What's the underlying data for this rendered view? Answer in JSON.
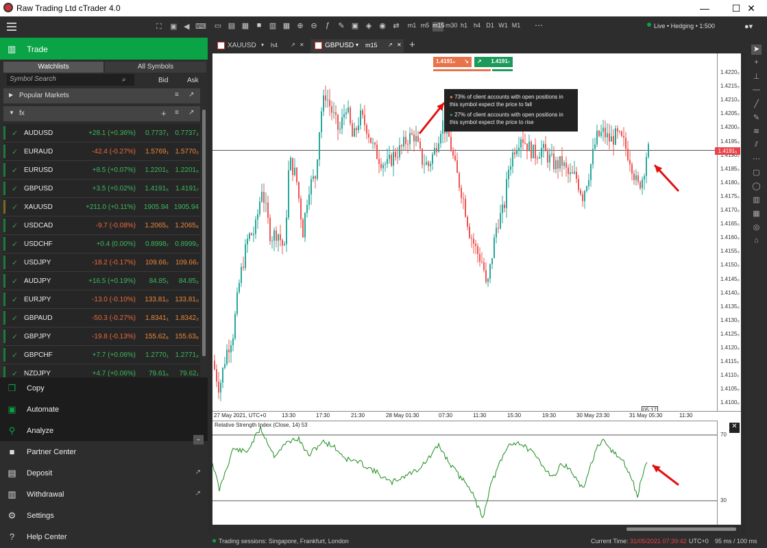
{
  "window": {
    "title": "Raw Trading Ltd cTrader 4.0",
    "minimize": "—",
    "maximize": "☐",
    "close": "✕"
  },
  "trade": {
    "title": "Trade"
  },
  "watch_tabs": [
    "Watchlists",
    "All Symbols"
  ],
  "search": {
    "placeholder": "Symbol Search",
    "bid": "Bid",
    "ask": "Ask"
  },
  "sections": {
    "popular": "Popular Markets",
    "fx": "fx"
  },
  "symbols": [
    {
      "sym": "AUDUSD",
      "chg": "+28.1 (+0.36%)",
      "bid": "0.7737₁",
      "ask": "0.7737₃",
      "dir": "g"
    },
    {
      "sym": "EURAUD",
      "chg": "-42.4 (-0.27%)",
      "bid": "1.5769₁",
      "ask": "1.5770₂",
      "dir": "r"
    },
    {
      "sym": "EURUSD",
      "chg": "+8.5 (+0.07%)",
      "bid": "1.2201₅",
      "ask": "1.2201₆",
      "dir": "g"
    },
    {
      "sym": "GBPUSD",
      "chg": "+3.5 (+0.02%)",
      "bid": "1.4191₅",
      "ask": "1.4191₇",
      "dir": "g"
    },
    {
      "sym": "XAUUSD",
      "chg": "+211.0 (+0.11%)",
      "bid": "1905.94",
      "ask": "1905.94",
      "dir": "g"
    },
    {
      "sym": "USDCAD",
      "chg": "-9.7 (-0.08%)",
      "bid": "1.2065₆",
      "ask": "1.2065₈",
      "dir": "r"
    },
    {
      "sym": "USDCHF",
      "chg": "+0.4 (0.00%)",
      "bid": "0.8998₇",
      "ask": "0.8999₀",
      "dir": "g"
    },
    {
      "sym": "USDJPY",
      "chg": "-18.2 (-0.17%)",
      "bid": "109.66₇",
      "ask": "109.66₇",
      "dir": "r"
    },
    {
      "sym": "AUDJPY",
      "chg": "+16.5 (+0.19%)",
      "bid": "84.85₁",
      "ask": "84.85₃",
      "dir": "g"
    },
    {
      "sym": "EURJPY",
      "chg": "-13.0 (-0.10%)",
      "bid": "133.81₀",
      "ask": "133.81₀",
      "dir": "r"
    },
    {
      "sym": "GBPAUD",
      "chg": "-50.3 (-0.27%)",
      "bid": "1.8341₁",
      "ask": "1.8342₂",
      "dir": "r"
    },
    {
      "sym": "GBPJPY",
      "chg": "-19.8 (-0.13%)",
      "bid": "155.62₈",
      "ask": "155.63₈",
      "dir": "r"
    },
    {
      "sym": "GBPCHF",
      "chg": "+7.7 (+0.06%)",
      "bid": "1.2770₁",
      "ask": "1.2771₂",
      "dir": "g"
    },
    {
      "sym": "NZDJPY",
      "chg": "+4.7 (+0.06%)",
      "bid": "79.61₅",
      "ask": "79.62₁",
      "dir": "g"
    }
  ],
  "menu": [
    "Copy",
    "Automate",
    "Analyze",
    "Partner Center",
    "Deposit",
    "Withdrawal",
    "Settings",
    "Help Center"
  ],
  "account": "Live • Hedging • 1:500",
  "timeframes": [
    "m1",
    "m5",
    "m15",
    "m30",
    "h1",
    "h4",
    "D1",
    "W1",
    "M1"
  ],
  "chart_tabs": [
    {
      "sym": "XAUUSD",
      "tf": "h4"
    },
    {
      "sym": "GBPUSD",
      "tf": "m15"
    }
  ],
  "quote": {
    "sell": "1.4191₅",
    "buy": "1.4191₇",
    "current": "1.4191₅"
  },
  "sentiment": [
    "73% of client accounts with open positions in this symbol expect the price to fall",
    "27% of client accounts with open positions in this symbol expect the price to rise"
  ],
  "yticks": [
    "1.4220₀",
    "1.4215₀",
    "1.4210₀",
    "1.4205₀",
    "1.4200₀",
    "1.4195₀",
    "1.4190₀",
    "1.4185₀",
    "1.4180₀",
    "1.4175₀",
    "1.4170₀",
    "1.4165₀",
    "1.4160₀",
    "1.4155₀",
    "1.4150₀",
    "1.4145₀",
    "1.4140₀",
    "1.4135₀",
    "1.4130₀",
    "1.4125₀",
    "1.4120₀",
    "1.4115₀",
    "1.4110₀",
    "1.4105₀",
    "1.4100₀"
  ],
  "xticks": [
    "27 May 2021, UTC+0",
    "13:30",
    "17:30",
    "21:30",
    "28 May 01:30",
    "07:30",
    "11:30",
    "15:30",
    "19:30",
    "30 May 23:30",
    "31 May 05:30",
    "11:30"
  ],
  "time_marker": "05:17",
  "rsi": {
    "label": "Relative Strength Index (Close, 14) 53",
    "levels": [
      "70",
      "30"
    ]
  },
  "status": {
    "sessions": "Trading sessions: Singapore, Frankfurt, London",
    "current_time_label": "Current Time:",
    "current_time": "31/05/2021 07:39:42",
    "tz": "UTC+0",
    "latency": "95 ms / 100 ms"
  }
}
